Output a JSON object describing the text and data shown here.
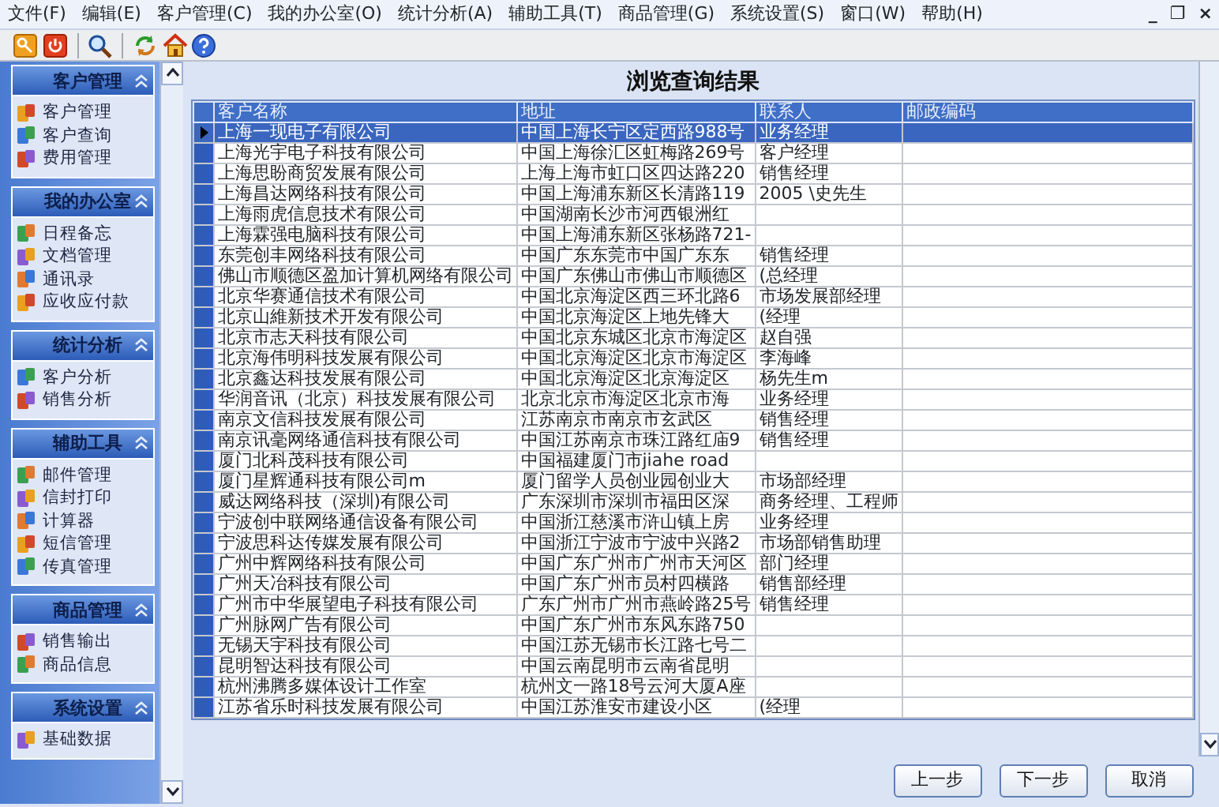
{
  "menu": [
    "文件(F)",
    "编辑(E)",
    "客户管理(C)",
    "我的办公室(O)",
    "统计分析(A)",
    "辅助工具(T)",
    "商品管理(G)",
    "系统设置(S)",
    "窗口(W)",
    "帮助(H)"
  ],
  "window_controls": [
    "_",
    "❐",
    "×"
  ],
  "sidebar": [
    {
      "title": "客户管理",
      "expanded": true,
      "items": [
        "客户管理",
        "客户查询",
        "费用管理"
      ]
    },
    {
      "title": "我的办公室",
      "expanded": true,
      "items": [
        "日程备忘",
        "文档管理",
        "通讯录",
        "应收应付款"
      ]
    },
    {
      "title": "统计分析",
      "expanded": true,
      "items": [
        "客户分析",
        "销售分析"
      ]
    },
    {
      "title": "辅助工具",
      "expanded": true,
      "items": [
        "邮件管理",
        "信封打印",
        "计算器",
        "短信管理",
        "传真管理"
      ]
    },
    {
      "title": "商品管理",
      "expanded": true,
      "items": [
        "销售输出",
        "商品信息"
      ]
    },
    {
      "title": "系统设置",
      "expanded": true,
      "items": [
        "基础数据"
      ]
    }
  ],
  "title": "浏览查询结果",
  "table": {
    "columns": [
      "客户名称",
      "地址",
      "联系人",
      "邮政编码"
    ],
    "rows": [
      {
        "cells": [
          "上海一现电子有限公司",
          "中国上海长宁区定西路988号",
          "业务经理"
        ],
        "selected": true
      },
      {
        "cells": [
          "上海光宇电子科技有限公司",
          "中国上海徐汇区虹梅路269号",
          "客户经理"
        ],
        "selected": false
      },
      {
        "cells": [
          "上海思盼商贸发展有限公司",
          "上海上海市虹口区四达路220",
          "销售经理"
        ],
        "selected": false
      },
      {
        "cells": [
          "上海昌达网络科技有限公司",
          "中国上海浦东新区长清路119",
          "2005 \\史先生"
        ],
        "selected": false
      },
      {
        "cells": [
          "上海雨虎信息技术有限公司",
          "中国湖南长沙市河西银洲红",
          ""
        ],
        "selected": false
      },
      {
        "cells": [
          "上海霖强电脑科技有限公司",
          "中国上海浦东新区张杨路721-",
          ""
        ],
        "selected": false
      },
      {
        "cells": [
          "东莞创丰网络科技有限公司",
          "中国广东东莞市中国广东东",
          "销售经理"
        ],
        "selected": false
      },
      {
        "cells": [
          "佛山市顺德区盈加计算机网络有限公司",
          "中国广东佛山市佛山市顺德区",
          "(总经理"
        ],
        "selected": false
      },
      {
        "cells": [
          "北京华赛通信技术有限公司",
          "中国北京海淀区西三环北路6",
          "市场发展部经理"
        ],
        "selected": false
      },
      {
        "cells": [
          "北京山維新技术开发有限公司",
          "中国北京海淀区上地先锋大",
          "(经理"
        ],
        "selected": false
      },
      {
        "cells": [
          "北京市志天科技有限公司",
          "中国北京东城区北京市海淀区",
          "赵自强"
        ],
        "selected": false
      },
      {
        "cells": [
          "北京海伟明科技发展有限公司",
          "中国北京海淀区北京市海淀区",
          "李海峰"
        ],
        "selected": false
      },
      {
        "cells": [
          "北京鑫达科技发展有限公司",
          "中国北京海淀区北京海淀区",
          "杨先生m"
        ],
        "selected": false
      },
      {
        "cells": [
          "华润音讯（北京）科技发展有限公司",
          "北京北京市海淀区北京市海",
          "业务经理"
        ],
        "selected": false
      },
      {
        "cells": [
          "南京文信科技发展有限公司",
          "江苏南京市南京市玄武区",
          "销售经理"
        ],
        "selected": false
      },
      {
        "cells": [
          "南京讯毫网络通信科技有限公司",
          "中国江苏南京市珠江路红庙9",
          "销售经理"
        ],
        "selected": false
      },
      {
        "cells": [
          "厦门北科茂科技有限公司",
          "中国福建厦门市jiahe road",
          ""
        ],
        "selected": false
      },
      {
        "cells": [
          "厦门星辉通科技有限公司m",
          "厦门留学人员创业园创业大",
          "市场部经理"
        ],
        "selected": false
      },
      {
        "cells": [
          "威达网络科技（深圳)有限公司",
          "广东深圳市深圳市福田区深",
          "商务经理、工程师"
        ],
        "selected": false
      },
      {
        "cells": [
          "宁波创中联网络通信设备有限公司",
          "中国浙江慈溪市浒山镇上房",
          "业务经理"
        ],
        "selected": false
      },
      {
        "cells": [
          "宁波思科达传媒发展有限公司",
          "中国浙江宁波市宁波中兴路2",
          "市场部销售助理"
        ],
        "selected": false
      },
      {
        "cells": [
          "广州中辉网络科技有限公司",
          "中国广东广州市广州市天河区",
          "部门经理"
        ],
        "selected": false
      },
      {
        "cells": [
          "广州天冶科技有限公司",
          "中国广东广州市员村四横路",
          "销售部经理"
        ],
        "selected": false
      },
      {
        "cells": [
          "广州市中华展望电子科技有限公司",
          "广东广州市广州市燕岭路25号",
          "销售经理"
        ],
        "selected": false
      },
      {
        "cells": [
          "广州脉网广告有限公司",
          "中国广东广州市东风东路750",
          ""
        ],
        "selected": false
      },
      {
        "cells": [
          "无锡天宇科技有限公司",
          "中国江苏无锡市长江路七号二",
          ""
        ],
        "selected": false
      },
      {
        "cells": [
          "昆明智达科技有限公司",
          "中国云南昆明市云南省昆明",
          ""
        ],
        "selected": false
      },
      {
        "cells": [
          "杭州沸腾多媒体设计工作室",
          "杭州文一路18号云河大厦A座",
          ""
        ],
        "selected": false
      },
      {
        "cells": [
          "江苏省乐时科技发展有限公司",
          "中国江苏淮安市建设小区",
          "(经理"
        ],
        "selected": false
      }
    ]
  },
  "buttons": [
    "上一步",
    "下一步",
    "取消"
  ]
}
